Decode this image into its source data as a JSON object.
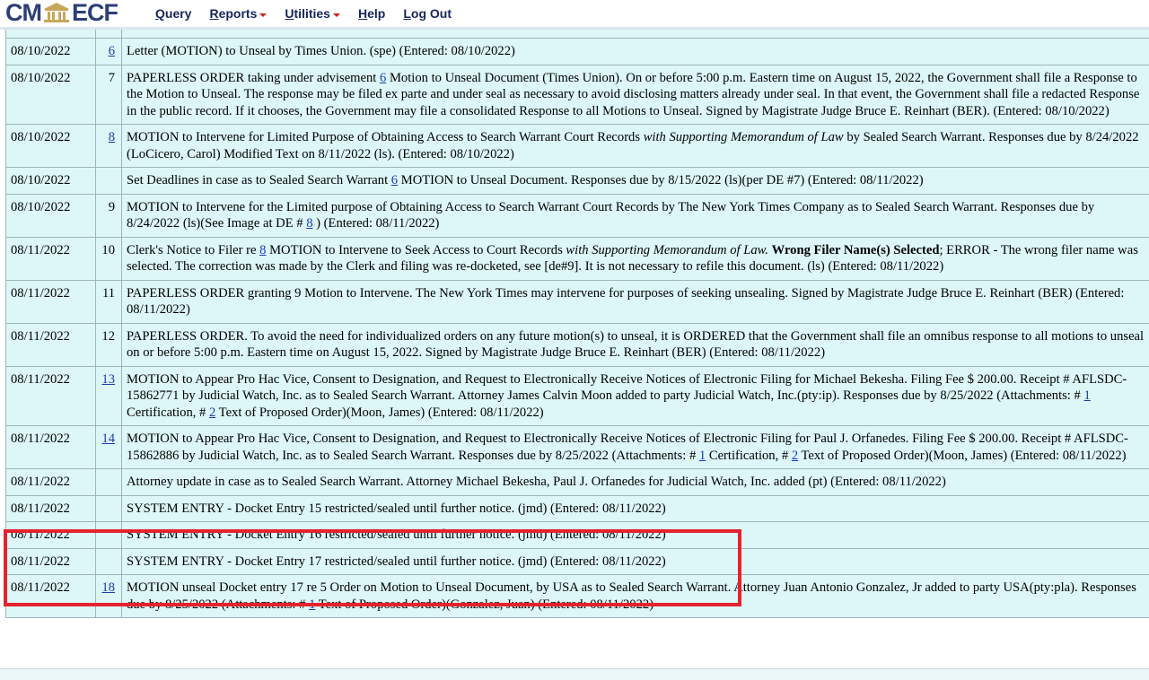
{
  "header": {
    "logo_left": "CM",
    "logo_right": "ECF",
    "menu": [
      {
        "label": "Query",
        "caret": false
      },
      {
        "label": "Reports",
        "caret": true
      },
      {
        "label": "Utilities",
        "caret": true
      },
      {
        "label": "Help",
        "caret": false
      },
      {
        "label": "Log Out",
        "caret": false
      }
    ]
  },
  "colors": {
    "table_bg": "#ddf6f7",
    "link": "#1a3db5",
    "highlight": "#e5222d",
    "logo": "#2b3f78"
  },
  "rows": [
    {
      "date": "08/10/2022",
      "num": "6",
      "num_link": true,
      "segments": [
        {
          "t": "Letter (MOTION) to Unseal by Times Union. (spe) (Entered: 08/10/2022)"
        }
      ]
    },
    {
      "date": "08/10/2022",
      "num": "7",
      "num_link": false,
      "segments": [
        {
          "t": "PAPERLESS ORDER taking under advisement "
        },
        {
          "t": "6",
          "link": true
        },
        {
          "t": " Motion to Unseal Document (Times Union). On or before 5:00 p.m. Eastern time on August 15, 2022, the Government shall file a Response to the Motion to Unseal. The response may be filed ex parte and under seal as necessary to avoid disclosing matters already under seal. In that event, the Government shall file a redacted Response in the public record. If it chooses, the Government may file a consolidated Response to all Motions to Unseal. Signed by Magistrate Judge Bruce E. Reinhart (BER). (Entered: 08/10/2022)"
        }
      ]
    },
    {
      "date": "08/10/2022",
      "num": "8",
      "num_link": true,
      "segments": [
        {
          "t": "MOTION to Intervene for Limited Purpose of Obtaining Access to Search Warrant Court Records "
        },
        {
          "t": "with Supporting Memorandum of Law",
          "i": true
        },
        {
          "t": " by Sealed Search Warrant. Responses due by 8/24/2022 (LoCicero, Carol) Modified Text on 8/11/2022 (ls). (Entered: 08/10/2022)"
        }
      ]
    },
    {
      "date": "08/10/2022",
      "num": "",
      "num_link": false,
      "segments": [
        {
          "t": "Set Deadlines in case as to Sealed Search Warrant "
        },
        {
          "t": "6",
          "link": true
        },
        {
          "t": " MOTION to Unseal Document. Responses due by 8/15/2022 (ls)(per DE #7) (Entered: 08/11/2022)"
        }
      ]
    },
    {
      "date": "08/10/2022",
      "num": "9",
      "num_link": false,
      "segments": [
        {
          "t": "MOTION to Intervene for the Limited purpose of Obtaining Access to Search Warrant Court Records by The New York Times Company as to Sealed Search Warrant. Responses due by 8/24/2022 (ls)(See Image at DE # "
        },
        {
          "t": "8",
          "link": true
        },
        {
          "t": " ) (Entered: 08/11/2022)"
        }
      ]
    },
    {
      "date": "08/11/2022",
      "num": "10",
      "num_link": false,
      "segments": [
        {
          "t": "Clerk's Notice to Filer re "
        },
        {
          "t": "8",
          "link": true
        },
        {
          "t": " MOTION to Intervene to Seek Access to Court Records "
        },
        {
          "t": "with Supporting Memorandum of Law.",
          "i": true
        },
        {
          "t": " "
        },
        {
          "t": "Wrong Filer Name(s) Selected",
          "b": true
        },
        {
          "t": "; ERROR - The wrong filer name was selected. The correction was made by the Clerk and filing was re-docketed, see [de#9]. It is not necessary to refile this document. (ls) (Entered: 08/11/2022)"
        }
      ]
    },
    {
      "date": "08/11/2022",
      "num": "11",
      "num_link": false,
      "segments": [
        {
          "t": "PAPERLESS ORDER granting 9 Motion to Intervene. The New York Times may intervene for purposes of seeking unsealing. Signed by Magistrate Judge Bruce E. Reinhart (BER) (Entered: 08/11/2022)"
        }
      ]
    },
    {
      "date": "08/11/2022",
      "num": "12",
      "num_link": false,
      "segments": [
        {
          "t": "PAPERLESS ORDER. To avoid the need for individualized orders on any future motion(s) to unseal, it is ORDERED that the Government shall file an omnibus response to all motions to unseal on or before 5:00 p.m. Eastern time on August 15, 2022. Signed by Magistrate Judge Bruce E. Reinhart (BER) (Entered: 08/11/2022)"
        }
      ]
    },
    {
      "date": "08/11/2022",
      "num": "13",
      "num_link": true,
      "segments": [
        {
          "t": "MOTION to Appear Pro Hac Vice, Consent to Designation, and Request to Electronically Receive Notices of Electronic Filing for Michael Bekesha. Filing Fee $ 200.00. Receipt # AFLSDC-15862771 by Judicial Watch, Inc. as to Sealed Search Warrant. Attorney James Calvin Moon added to party Judicial Watch, Inc.(pty:ip). Responses due by 8/25/2022 (Attachments: # "
        },
        {
          "t": "1",
          "link": true
        },
        {
          "t": " Certification, # "
        },
        {
          "t": "2",
          "link": true
        },
        {
          "t": " Text of Proposed Order)(Moon, James) (Entered: 08/11/2022)"
        }
      ]
    },
    {
      "date": "08/11/2022",
      "num": "14",
      "num_link": true,
      "segments": [
        {
          "t": "MOTION to Appear Pro Hac Vice, Consent to Designation, and Request to Electronically Receive Notices of Electronic Filing for Paul J. Orfanedes. Filing Fee $ 200.00. Receipt # AFLSDC-15862886 by Judicial Watch, Inc. as to Sealed Search Warrant. Responses due by 8/25/2022 (Attachments: # "
        },
        {
          "t": "1",
          "link": true
        },
        {
          "t": " Certification, # "
        },
        {
          "t": "2",
          "link": true
        },
        {
          "t": " Text of Proposed Order)(Moon, James) (Entered: 08/11/2022)"
        }
      ]
    },
    {
      "date": "08/11/2022",
      "num": "",
      "num_link": false,
      "segments": [
        {
          "t": "Attorney update in case as to Sealed Search Warrant. Attorney Michael Bekesha, Paul J. Orfanedes for Judicial Watch, Inc. added (pt) (Entered: 08/11/2022)"
        }
      ]
    },
    {
      "date": "08/11/2022",
      "num": "",
      "num_link": false,
      "segments": [
        {
          "t": "SYSTEM ENTRY - Docket Entry 15 restricted/sealed until further notice. (jmd) (Entered: 08/11/2022)"
        }
      ]
    },
    {
      "date": "08/11/2022",
      "num": "",
      "num_link": false,
      "segments": [
        {
          "t": "SYSTEM ENTRY - Docket Entry 16 restricted/sealed until further notice. (jmd) (Entered: 08/11/2022)"
        }
      ]
    },
    {
      "date": "08/11/2022",
      "num": "",
      "num_link": false,
      "segments": [
        {
          "t": "SYSTEM ENTRY - Docket Entry 17 restricted/sealed until further notice. (jmd) (Entered: 08/11/2022)"
        }
      ]
    },
    {
      "date": "08/11/2022",
      "num": "18",
      "num_link": true,
      "segments": [
        {
          "t": "MOTION unseal Docket entry 17 re 5 Order on Motion to Unseal Document, by USA as to Sealed Search Warrant. Attorney Juan Antonio Gonzalez, Jr added to party USA(pty:pla). Responses due by 8/25/2022 (Attachments: # "
        },
        {
          "t": "1",
          "link": true
        },
        {
          "t": " Text of Proposed Order)(Gonzalez, Juan) (Entered: 08/11/2022)"
        }
      ]
    }
  ]
}
